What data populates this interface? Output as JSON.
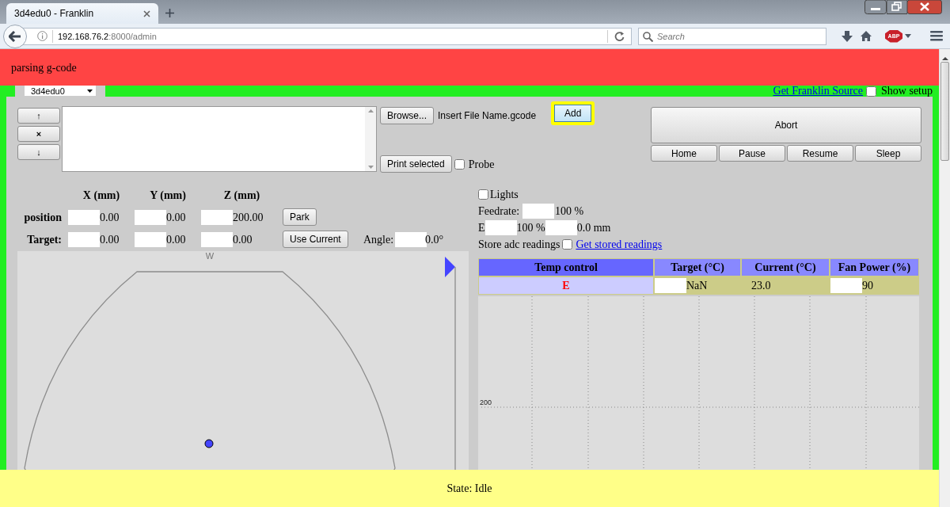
{
  "browser": {
    "tab_title": "3d4edu0 - Franklin",
    "url_host": "192.168.76.2",
    "url_path": ":8000/admin",
    "search_placeholder": "Search",
    "addon_badge": "ABP"
  },
  "banner": {
    "message": "parsing g-code"
  },
  "printer_select": {
    "value": "3d4edu0"
  },
  "header_links": {
    "source_link": "Get Franklin Source",
    "show_setup": {
      "label": "Show setup",
      "checked": false
    }
  },
  "queue": {
    "move_buttons": [
      "↑",
      "×",
      "↓"
    ],
    "browse_button": "Browse...",
    "file_name": "Insert File Name.gcode",
    "add_button": {
      "label": "Add",
      "highlighted": true
    },
    "print_button": "Print selected",
    "probe": {
      "label": "Probe",
      "checked": false
    }
  },
  "control_buttons": {
    "abort": "Abort",
    "row": [
      "Home",
      "Pause",
      "Resume",
      "Sleep"
    ]
  },
  "axes": {
    "columns": [
      "X (mm)",
      "Y (mm)",
      "Z (mm)"
    ],
    "position_label": "position",
    "position_values": [
      "0.00",
      "0.00",
      "200.00"
    ],
    "park_button": "Park",
    "target_label": "Target:",
    "target_values": [
      "0.00",
      "0.00",
      "0.00"
    ],
    "use_current_button": "Use Current",
    "angle_label": "Angle:",
    "angle_value": "0.0°"
  },
  "bed_map": {
    "direction_label": "W"
  },
  "lights": {
    "label": "Lights",
    "checked": false
  },
  "feedrate": {
    "label": "Feedrate:",
    "value": "100 %"
  },
  "extruder": {
    "label": "E",
    "flow": "100 %",
    "distance": "0.0 mm"
  },
  "adc": {
    "label": "Store adc readings",
    "checked": false,
    "link": "Get stored readings"
  },
  "temp_table": {
    "columns": [
      "Temp control",
      "Target (°C)",
      "Current (°C)",
      "Fan Power (%)"
    ],
    "rows": [
      {
        "name": "E",
        "target": "NaN",
        "current": "23.0",
        "fan_power": "90"
      }
    ]
  },
  "temp_graph": {
    "tick_label": "200"
  },
  "status_bar": "State: Idle"
}
